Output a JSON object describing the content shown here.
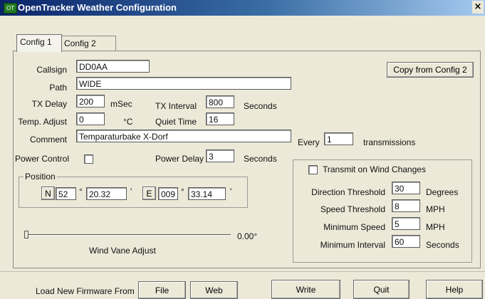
{
  "window": {
    "title": "OpenTracker Weather Configuration",
    "close_glyph": "×",
    "app_icon": "window-app-icon",
    "app_icon_text": "OT"
  },
  "tabs": [
    {
      "label": "Config 1"
    },
    {
      "label": "Config 2"
    }
  ],
  "form": {
    "callsign": {
      "label": "Callsign",
      "value": "DD0AA"
    },
    "path": {
      "label": "Path",
      "value": "WIDE"
    },
    "tx_delay": {
      "label": "TX Delay",
      "value": "200",
      "unit": "mSec"
    },
    "tx_interval": {
      "label": "TX Interval",
      "value": "800",
      "unit": "Seconds"
    },
    "temp_adjust": {
      "label": "Temp. Adjust",
      "value": "0",
      "unit": "°C"
    },
    "quiet_time": {
      "label": "Quiet Time",
      "value": "16"
    },
    "comment": {
      "label": "Comment",
      "value": "Temparaturbake X-Dorf"
    },
    "every": {
      "label": "Every",
      "value": "1",
      "unit": "transmissions"
    },
    "power_control": {
      "label": "Power Control",
      "checked": false
    },
    "power_delay": {
      "label": "Power Delay",
      "value": "3",
      "unit": "Seconds"
    },
    "copy_button": "Copy from Config 2"
  },
  "position": {
    "title": "Position",
    "lat_dir": "N",
    "lat_deg": "52",
    "lat_min": "20.32",
    "lon_dir": "E",
    "lon_deg": "009",
    "lon_min": "33.14",
    "deg_symbol": "°",
    "min_symbol": "'"
  },
  "wind_vane": {
    "label": "Wind Vane Adjust",
    "value_text": "0.00°",
    "slider_fraction": 0
  },
  "wind_changes": {
    "checkbox_label": "Transmit on Wind Changes",
    "checked": false,
    "direction_threshold": {
      "label": "Direction Threshold",
      "value": "30",
      "unit": "Degrees"
    },
    "speed_threshold": {
      "label": "Speed Threshold",
      "value": "8",
      "unit": "MPH"
    },
    "minimum_speed": {
      "label": "Minimum Speed",
      "value": "5",
      "unit": "MPH"
    },
    "minimum_interval": {
      "label": "Minimum Interval",
      "value": "60",
      "unit": "Seconds"
    }
  },
  "footer": {
    "load_label": "Load New Firmware From",
    "file_button": "File",
    "web_button": "Web",
    "write_button": "Write",
    "quit_button": "Quit",
    "help_button": "Help"
  },
  "colors": {
    "titlebar_start": "#0a246a",
    "titlebar_end": "#a6caf0",
    "window_bg": "#ece9d8"
  }
}
